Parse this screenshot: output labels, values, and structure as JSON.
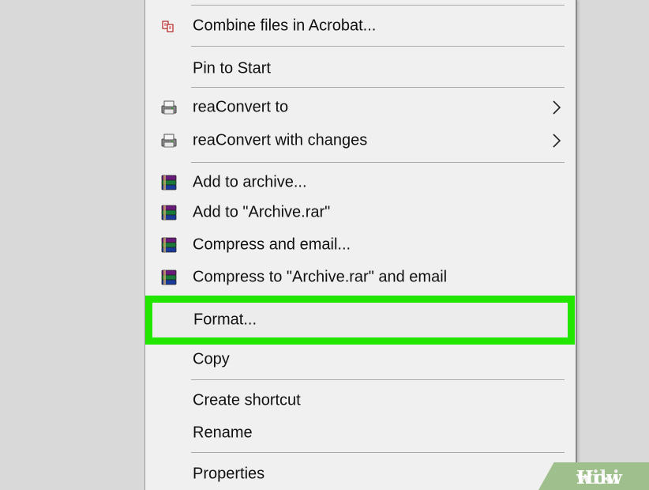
{
  "menu": {
    "items": [
      {
        "label": "Combine files in Acrobat...",
        "icon": "acrobat-combine-icon"
      },
      {
        "label": "Pin to Start"
      },
      {
        "label": "reaConvert to",
        "icon": "reaconvert-icon",
        "submenu": true
      },
      {
        "label": "reaConvert with changes",
        "icon": "reaconvert-icon",
        "submenu": true
      },
      {
        "label": "Add to archive...",
        "icon": "winrar-icon"
      },
      {
        "label": "Add to \"Archive.rar\"",
        "icon": "winrar-icon"
      },
      {
        "label": "Compress and email...",
        "icon": "winrar-icon"
      },
      {
        "label": "Compress to \"Archive.rar\" and email",
        "icon": "winrar-icon"
      },
      {
        "label": "Format...",
        "highlighted": true
      },
      {
        "label": "Copy"
      },
      {
        "label": "Create shortcut"
      },
      {
        "label": "Rename"
      },
      {
        "label": "Properties"
      }
    ]
  },
  "highlight_color": "#22e600",
  "watermark": {
    "part1": "wiki",
    "part2": "How"
  }
}
